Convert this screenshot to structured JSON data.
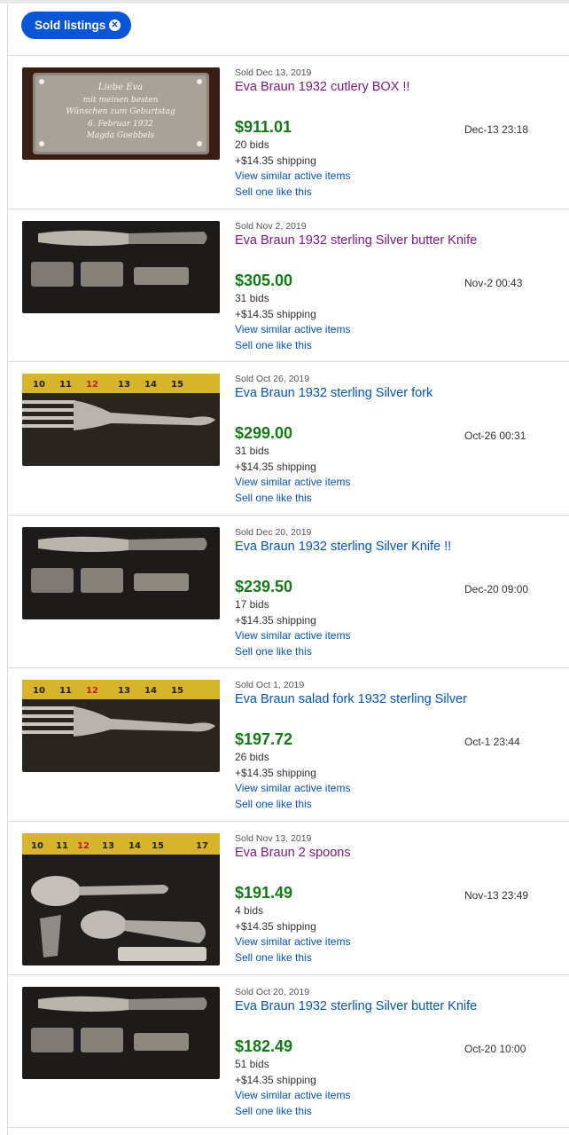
{
  "filter": {
    "chip_label": "Sold listings",
    "chip_close_icon": "close-circle-icon"
  },
  "listings": [
    {
      "sold_date": "Sold Dec 13, 2019",
      "title": "Eva Braun 1932 cutlery BOX !!",
      "title_visited": true,
      "price": "$911.01",
      "end_time": "Dec-13 23:18",
      "bids": "20 bids",
      "shipping": "+$14.35 shipping",
      "link_similar": "View similar active items",
      "link_sell": "Sell one like this",
      "thumb": {
        "kind": "plaque",
        "text": [
          "Liebe Eva",
          "mit meinen besten",
          "Wünschen zum Geburtstag",
          "6. Februar 1932",
          "Magda Goebbels"
        ]
      }
    },
    {
      "sold_date": "Sold Nov 2, 2019",
      "title": "Eva Braun 1932 sterling Silver butter Knife",
      "title_visited": true,
      "price": "$305.00",
      "end_time": "Nov-2 00:43",
      "bids": "31 bids",
      "shipping": "+$14.35 shipping",
      "link_similar": "View similar active items",
      "link_sell": "Sell one like this",
      "thumb": {
        "kind": "knife"
      }
    },
    {
      "sold_date": "Sold Oct 26, 2019",
      "title": "Eva Braun 1932 sterling Silver fork",
      "title_visited": false,
      "price": "$299.00",
      "end_time": "Oct-26 00:31",
      "bids": "31 bids",
      "shipping": "+$14.35 shipping",
      "link_similar": "View similar active items",
      "link_sell": "Sell one like this",
      "thumb": {
        "kind": "fork",
        "ruler": [
          "10",
          "11",
          "13",
          "14",
          "15"
        ]
      }
    },
    {
      "sold_date": "Sold Dec 20, 2019",
      "title": "Eva Braun 1932 sterling Silver Knife !!",
      "title_visited": false,
      "price": "$239.50",
      "end_time": "Dec-20 09:00",
      "bids": "17 bids",
      "shipping": "+$14.35 shipping",
      "link_similar": "View similar active items",
      "link_sell": "Sell one like this",
      "thumb": {
        "kind": "knife"
      }
    },
    {
      "sold_date": "Sold Oct 1, 2019",
      "title": "Eva Braun salad fork 1932 sterling Silver",
      "title_visited": false,
      "price": "$197.72",
      "end_time": "Oct-1 23:44",
      "bids": "26 bids",
      "shipping": "+$14.35 shipping",
      "link_similar": "View similar active items",
      "link_sell": "Sell one like this",
      "thumb": {
        "kind": "fork",
        "ruler": [
          "10",
          "11",
          "13",
          "14",
          "15"
        ]
      }
    },
    {
      "sold_date": "Sold Nov 13, 2019",
      "title": "Eva Braun 2 spoons",
      "title_visited": true,
      "price": "$191.49",
      "end_time": "Nov-13 23:49",
      "bids": "4 bids",
      "shipping": "+$14.35 shipping",
      "link_similar": "View similar active items",
      "link_sell": "Sell one like this",
      "thumb": {
        "kind": "spoons",
        "ruler": [
          "10",
          "11",
          "13",
          "14",
          "15",
          "17"
        ]
      }
    },
    {
      "sold_date": "Sold Oct 20, 2019",
      "title": "Eva Braun 1932 sterling Silver butter Knife",
      "title_visited": false,
      "price": "$182.49",
      "end_time": "Oct-20 10:00",
      "bids": "51 bids",
      "shipping": "+$14.35 shipping",
      "link_similar": "View similar active items",
      "link_sell": "Sell one like this",
      "thumb": {
        "kind": "knife"
      }
    }
  ],
  "colors": {
    "chip": "#0a54d6",
    "price": "#137a17",
    "link": "#0654ba",
    "visited": "#7b1b84"
  }
}
